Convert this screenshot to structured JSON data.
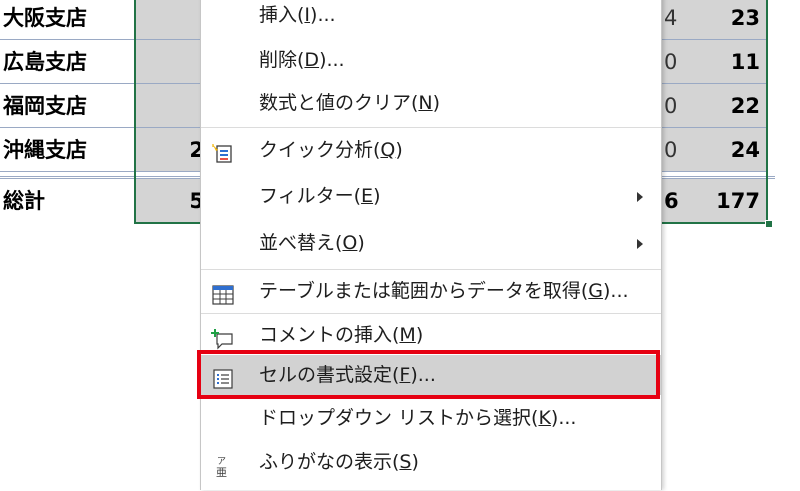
{
  "sheet": {
    "rows": [
      {
        "name": "大阪支店",
        "b": "",
        "f": "4",
        "g": "23"
      },
      {
        "name": "広島支店",
        "b": "",
        "f": "0",
        "g": "11"
      },
      {
        "name": "福岡支店",
        "b": "",
        "f": "0",
        "g": "22"
      },
      {
        "name": "沖縄支店",
        "b": "2",
        "f": "0",
        "g": "24"
      }
    ],
    "total": {
      "name": "総計",
      "b": "5",
      "f": "6",
      "g": "177"
    }
  },
  "menu": {
    "items": [
      {
        "text": "挿入(",
        "key": "I",
        "suffix": ")..."
      },
      {
        "text": "削除(",
        "key": "D",
        "suffix": ")..."
      },
      {
        "text": "数式と値のクリア(",
        "key": "N",
        "suffix": ")"
      },
      {
        "text": "クイック分析(",
        "key": "Q",
        "suffix": ")"
      },
      {
        "text": "フィルター(",
        "key": "E",
        "suffix": ")"
      },
      {
        "text": "並べ替え(",
        "key": "O",
        "suffix": ")"
      },
      {
        "text": "テーブルまたは範囲からデータを取得(",
        "key": "G",
        "suffix": ")..."
      },
      {
        "text": "コメントの挿入(",
        "key": "M",
        "suffix": ")"
      },
      {
        "text": "セルの書式設定(",
        "key": "F",
        "suffix": ")..."
      },
      {
        "text": "ドロップダウン リストから選択(",
        "key": "K",
        "suffix": ")..."
      },
      {
        "text": "ふりがなの表示(",
        "key": "S",
        "suffix": ")"
      }
    ],
    "icons": {
      "quick_analysis": "quick-analysis-icon",
      "table_range": "table-range-icon",
      "comment": "new-comment-icon",
      "format_cells": "format-cells-icon",
      "furigana": "furigana-icon"
    }
  },
  "colors": {
    "selection": "#217346",
    "highlight_box": "#e60012",
    "menu_hover": "#d2d2d2"
  }
}
